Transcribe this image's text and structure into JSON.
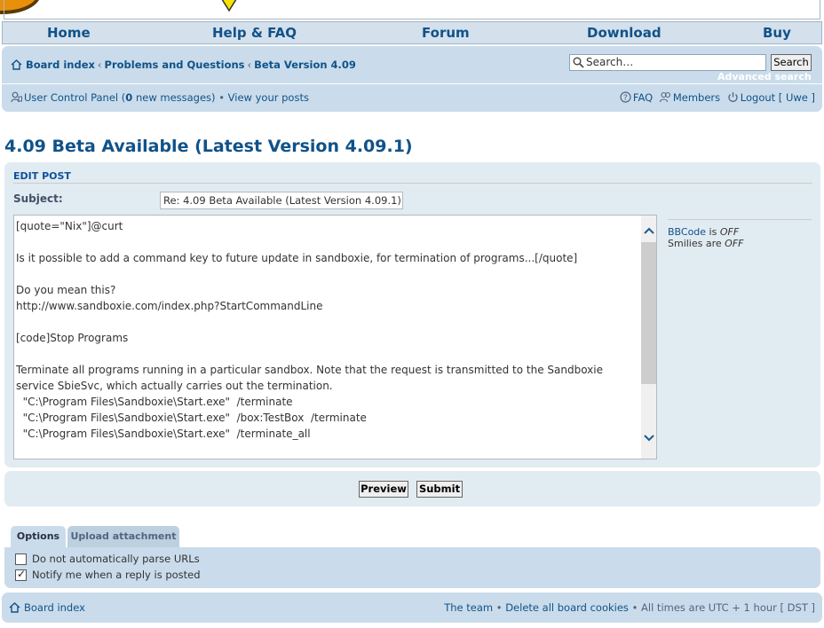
{
  "nav": {
    "items": [
      {
        "label": "Home"
      },
      {
        "label": "Help & FAQ"
      },
      {
        "label": "Forum"
      },
      {
        "label": "Download"
      },
      {
        "label": "Buy"
      }
    ]
  },
  "breadcrumbs": [
    "Board index",
    "Problems and Questions",
    "Beta Version 4.09"
  ],
  "breadcrumb_separator": "‹",
  "search": {
    "placeholder": "Search…",
    "button": "Search",
    "advanced": "Advanced search"
  },
  "ucp": {
    "label": "User Control Panel",
    "open_paren": " (",
    "new_count": "0",
    "new_messages": " new messages)",
    "bullet": " • ",
    "view_posts": "View your posts"
  },
  "right_links": {
    "faq": "FAQ",
    "members": "Members",
    "logout": "Logout [ Uwe ]"
  },
  "page_title": "4.09 Beta Available (Latest Version 4.09.1)",
  "edit": {
    "heading": "EDIT POST",
    "subject_label": "Subject:",
    "subject_value": "Re: 4.09 Beta Available (Latest Version 4.09.1)",
    "message_lines": "[quote=\"Nix\"]@curt\n\nIs it possible to add a command key to future update in sandboxie, for termination of programs...[/quote]\n\nDo you mean this?\nhttp://www.sandboxie.com/index.php?StartCommandLine\n\n[code]Stop Programs\n\nTerminate all programs running in a particular sandbox. Note that the request is transmitted to the Sandboxie\nservice SbieSvc, which actually carries out the termination.\n  \"C:\\Program Files\\Sandboxie\\Start.exe\"  /terminate\n  \"C:\\Program Files\\Sandboxie\\Start.exe\"  /box:TestBox  /terminate\n  \"C:\\Program Files\\Sandboxie\\Start.exe\"  /terminate_all",
    "bbcode_label": "BBCode",
    "bbcode_is": " is ",
    "bbcode_state": "OFF",
    "smilies_label": "Smilies are ",
    "smilies_state": "OFF"
  },
  "buttons": {
    "preview": "Preview",
    "submit": "Submit"
  },
  "tabs": {
    "options": "Options",
    "upload": "Upload attachment"
  },
  "options": [
    {
      "label": "Do not automatically parse URLs",
      "checked": false
    },
    {
      "label": "Notify me when a reply is posted",
      "checked": true
    }
  ],
  "footer": {
    "home": "Board index",
    "team": "The team",
    "bullet": " • ",
    "delete_cookies": "Delete all board cookies",
    "times": " • All times are UTC + 1 hour [ DST ]"
  },
  "colors": {
    "link": "#105289",
    "panel": "#e1ebf2",
    "navbar": "#cadceb"
  }
}
